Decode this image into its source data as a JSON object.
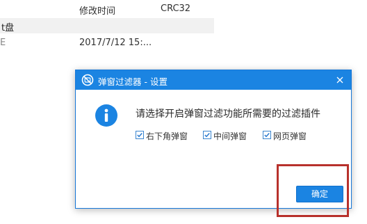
{
  "background": {
    "header": {
      "modified_col": "修改时间",
      "crc_col": "CRC32"
    },
    "group_row_label": "t盘",
    "file_row": {
      "left_fragment": "E",
      "modified": "2017/7/12 15:..."
    }
  },
  "dialog": {
    "title": "弹窗过滤器 - 设置",
    "close_glyph": "×",
    "prompt": "请选择开启弹窗过滤功能所需要的过滤插件",
    "options": [
      {
        "label": "右下角弹窗",
        "checked": true
      },
      {
        "label": "中间弹窗",
        "checked": true
      },
      {
        "label": "网页弹窗",
        "checked": true
      }
    ],
    "confirm_label": "确定"
  },
  "colors": {
    "titlebar": "#1b84e2",
    "accent": "#1b84e2",
    "annotation": "#b8312c"
  },
  "icons": {
    "title_icon": "no-popup-icon",
    "info_icon": "info-icon",
    "checkbox_mark": "checkmark-icon"
  }
}
